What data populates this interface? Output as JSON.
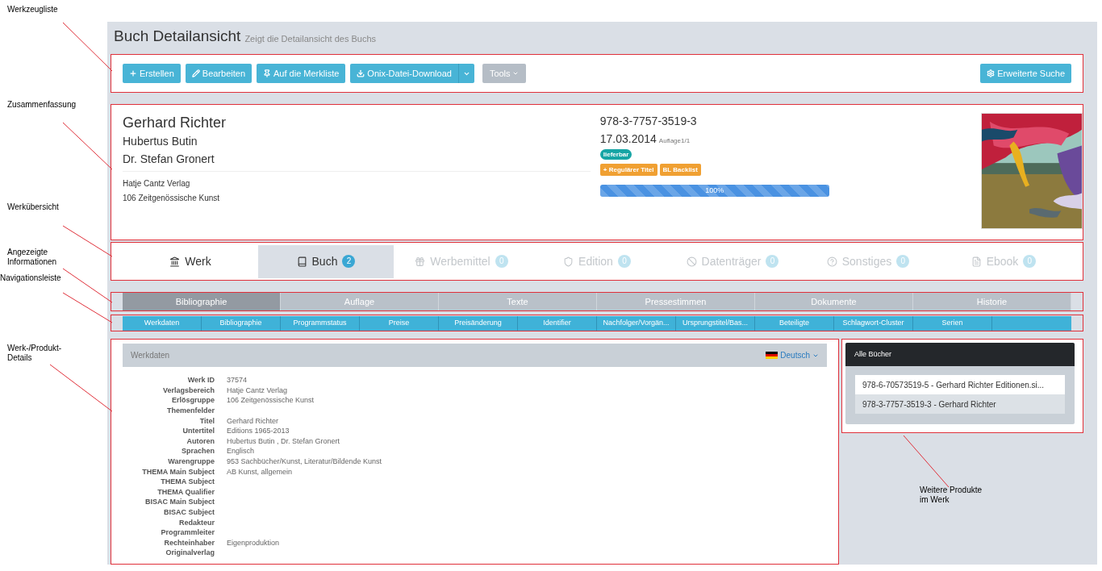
{
  "annotations": [
    {
      "text": "Werkzeugliste"
    },
    {
      "text": "Zusammenfassung"
    },
    {
      "text": "Werkübersicht"
    },
    {
      "text": "Angezeigte\nInformationen"
    },
    {
      "text": "Navigationsleiste"
    },
    {
      "text": "Werk-/Produkt-\nDetails"
    },
    {
      "text": "Weitere Produkte\nim Werk"
    }
  ],
  "page": {
    "title": "Buch Detailansicht",
    "subtitle": "Zeigt die Detailansicht des Buchs"
  },
  "toolbar": {
    "buttons": [
      {
        "label": "Erstellen",
        "kind": "primary"
      },
      {
        "label": "Bearbeiten",
        "kind": "primary"
      },
      {
        "label": "Auf die Merkliste",
        "kind": "primary"
      },
      {
        "label": "Onix-Datei-Download",
        "kind": "split"
      },
      {
        "label": "Tools",
        "kind": "menu"
      }
    ],
    "search_button": {
      "label": "Erweiterte Suche"
    }
  },
  "summary": {
    "title": "Gerhard Richter",
    "contributors": [
      "Hubertus Butin",
      "Dr. Stefan Gronert"
    ],
    "publisher": "Hatje Cantz Verlag",
    "group": "106 Zeitgenössische Kunst",
    "isbn": "978-3-7757-3519-3",
    "date": "17.03.2014",
    "edition": "Auflage1/1",
    "status": "lieferbar",
    "tags": [
      "+ Regulärer Titel",
      "BL Backlist"
    ],
    "progress": {
      "level": 1,
      "reading": "100%"
    }
  },
  "work_tabs": [
    {
      "label": "Werk",
      "selected": false,
      "disabled": false
    },
    {
      "label": "Buch",
      "count": "2",
      "selected": true,
      "disabled": false
    },
    {
      "label": "Werbemittel",
      "count": "0",
      "selected": false,
      "disabled": true
    },
    {
      "label": "Edition",
      "count": "0",
      "selected": false,
      "disabled": true
    },
    {
      "label": "Datenträger",
      "count": "0",
      "selected": false,
      "disabled": true
    },
    {
      "label": "Sonstiges",
      "count": "0",
      "selected": false,
      "disabled": true
    },
    {
      "label": "Ebook",
      "count": "0",
      "selected": false,
      "disabled": true
    }
  ],
  "info_tabs": [
    {
      "label": "Bibliographie",
      "selected": true
    },
    {
      "label": "Auflage",
      "selected": false
    },
    {
      "label": "Texte",
      "selected": false
    },
    {
      "label": "Pressestimmen",
      "selected": false
    },
    {
      "label": "Dokumente",
      "selected": false
    },
    {
      "label": "Historie",
      "selected": false
    }
  ],
  "nav": [
    "Werkdaten",
    "Bibliographie",
    "Programmstatus",
    "Preise",
    "Preisänderung",
    "Identifier",
    "Nachfolger/Vorgän...",
    "Ursprungstitel/Bas...",
    "Beteiligte",
    "Schlagwort-Cluster",
    "Serien"
  ],
  "details": {
    "header": "Werkdaten",
    "language": "Deutsch",
    "fields": [
      {
        "label": "Werk ID",
        "value": "37574"
      },
      {
        "label": "Verlagsbereich",
        "value": "Hatje Cantz Verlag"
      },
      {
        "label": "Erlösgruppe",
        "value": "106 Zeitgenössische Kunst"
      },
      {
        "label": "Themenfelder"
      },
      {
        "label": "Titel",
        "value": "Gerhard Richter"
      },
      {
        "label": "Untertitel",
        "value": "Editions 1965-2013"
      },
      {
        "label": "Autoren",
        "value": "Hubertus Butin , Dr. Stefan Gronert"
      },
      {
        "label": "Sprachen",
        "value": "Englisch"
      },
      {
        "label": "Warengruppe",
        "value": "953 Sachbücher/Kunst, Literatur/Bildende Kunst"
      },
      {
        "label": "THEMA Main Subject",
        "value": "AB Kunst, allgemein"
      },
      {
        "label": "THEMA Subject"
      },
      {
        "label": "THEMA Qualifier"
      },
      {
        "label": "BISAC Main Subject"
      },
      {
        "label": "BISAC Subject"
      },
      {
        "label": "Redakteur"
      },
      {
        "label": "Programmleiter"
      },
      {
        "label": "Rechteinhaber",
        "value": "Eigenproduktion"
      },
      {
        "label": "Originalverlag"
      }
    ]
  },
  "books": {
    "header": "Alle Bücher",
    "items": [
      {
        "label": "978-6-70573519-5 - Gerhard Richter Editionen.si...",
        "selected": false
      },
      {
        "label": "978-3-7757-3519-3 - Gerhard Richter",
        "selected": true
      }
    ]
  }
}
